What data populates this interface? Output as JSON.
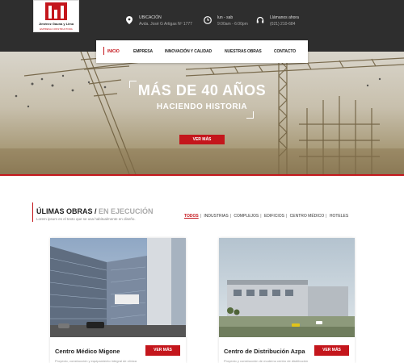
{
  "logo": {
    "name": "Jiménez Gauna y Lima",
    "tagline": "EMPRESA CONSTRUCTORA"
  },
  "contact": [
    {
      "icon": "location-pin-icon",
      "label": "UBICACIÓN",
      "value": "Avda. José G Artigas Nº 1777"
    },
    {
      "icon": "clock-icon",
      "label": "lun - sab",
      "value": "9:00am - 6:00pm"
    },
    {
      "icon": "headset-icon",
      "label": "Llámanos ahora",
      "value": "(021) 210-684"
    }
  ],
  "nav": [
    "INICIO",
    "EMPRESA",
    "INNOVACIÓN Y CALIDAD",
    "NUESTRAS OBRAS",
    "CONTACTO"
  ],
  "hero": {
    "title": "MÁS DE 40 AÑOS",
    "subtitle": "HACIENDO HISTORIA",
    "button": "VER MÁS"
  },
  "section": {
    "title": "ÚLIMAS OBRAS",
    "slash": " /",
    "title_accent": " EN EJECUCIÓN",
    "description": "Lorem ipsum es el texto que se usa habitualmente en diseño.",
    "filters": [
      "TODOS",
      "INDUSTRIAS",
      "COMPLEJOS",
      "EDIFICIOS",
      "CENTRO MÉDICO",
      "HOTELES"
    ]
  },
  "cards": [
    {
      "title": "Centro Médico Migone",
      "button": "VER MÁS",
      "description": "Proyecto, construcción y equipamiento integral de clínica"
    },
    {
      "title": "Centro de Distribución Azpa",
      "button": "VER MÁS",
      "description": "Proyecto y construcción de moderno centro de distribución"
    }
  ],
  "colors": {
    "accent": "#c4161c",
    "topbar": "#2e2e2e"
  }
}
